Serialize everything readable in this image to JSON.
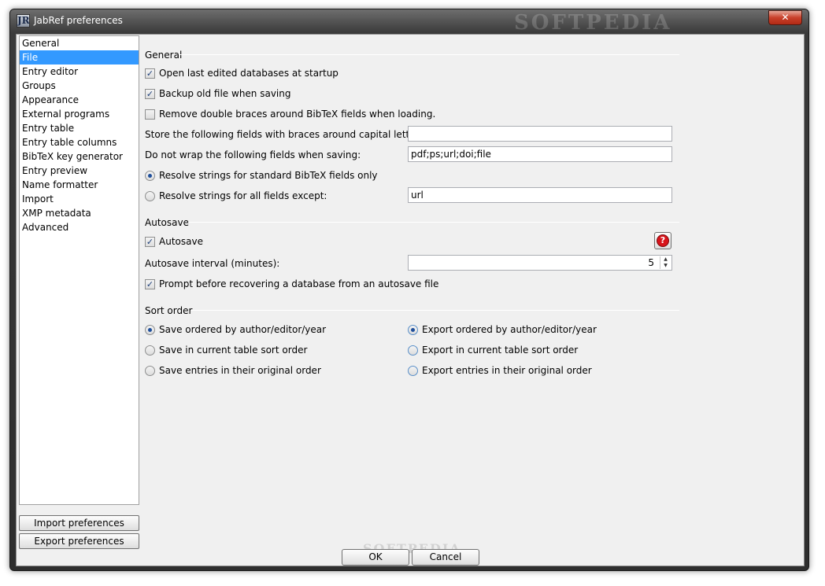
{
  "window": {
    "title": "JabRef preferences",
    "close_glyph": "✕",
    "watermark": "SOFTPEDIA"
  },
  "sidebar": {
    "items": [
      {
        "label": "General"
      },
      {
        "label": "File"
      },
      {
        "label": "Entry editor"
      },
      {
        "label": "Groups"
      },
      {
        "label": "Appearance"
      },
      {
        "label": "External programs"
      },
      {
        "label": "Entry table"
      },
      {
        "label": "Entry table columns"
      },
      {
        "label": "BibTeX key generator"
      },
      {
        "label": "Entry preview"
      },
      {
        "label": "Name formatter"
      },
      {
        "label": "Import"
      },
      {
        "label": "XMP metadata"
      },
      {
        "label": "Advanced"
      }
    ],
    "selected": "File",
    "import_button": "Import preferences",
    "export_button": "Export preferences"
  },
  "general": {
    "title": "General",
    "open_last": {
      "label": "Open last edited databases at startup",
      "checked": true
    },
    "backup": {
      "label": "Backup old file when saving",
      "checked": true
    },
    "remove_braces": {
      "label": "Remove double braces around BibTeX fields when loading.",
      "checked": false
    },
    "braces_fields": {
      "label": "Store the following fields with braces around capital letters:",
      "value": ""
    },
    "nowrap_fields": {
      "label": "Do not wrap the following fields when saving:",
      "value": "pdf;ps;url;doi;file"
    },
    "resolve_standard": {
      "label": "Resolve strings for standard BibTeX fields only",
      "selected": true
    },
    "resolve_all": {
      "label": "Resolve strings for all fields except:",
      "value": "url",
      "selected": false
    }
  },
  "autosave": {
    "title": "Autosave",
    "enabled": {
      "label": "Autosave",
      "checked": true
    },
    "help_glyph": "?",
    "interval": {
      "label": "Autosave interval (minutes):",
      "value": "5"
    },
    "prompt": {
      "label": "Prompt before recovering a database from an autosave file",
      "checked": true
    }
  },
  "sort_order": {
    "title": "Sort order",
    "save_options": [
      {
        "label": "Save ordered by author/editor/year",
        "selected": true
      },
      {
        "label": "Save in current table sort order",
        "selected": false
      },
      {
        "label": "Save entries in their original order",
        "selected": false
      }
    ],
    "export_options": [
      {
        "label": "Export ordered by author/editor/year",
        "selected": true
      },
      {
        "label": "Export in current table sort order",
        "selected": false
      },
      {
        "label": "Export entries in their original order",
        "selected": false
      }
    ]
  },
  "footer": {
    "ok": "OK",
    "cancel": "Cancel"
  },
  "colors": {
    "selection": "#3399ff",
    "help_red": "#d8141b"
  }
}
